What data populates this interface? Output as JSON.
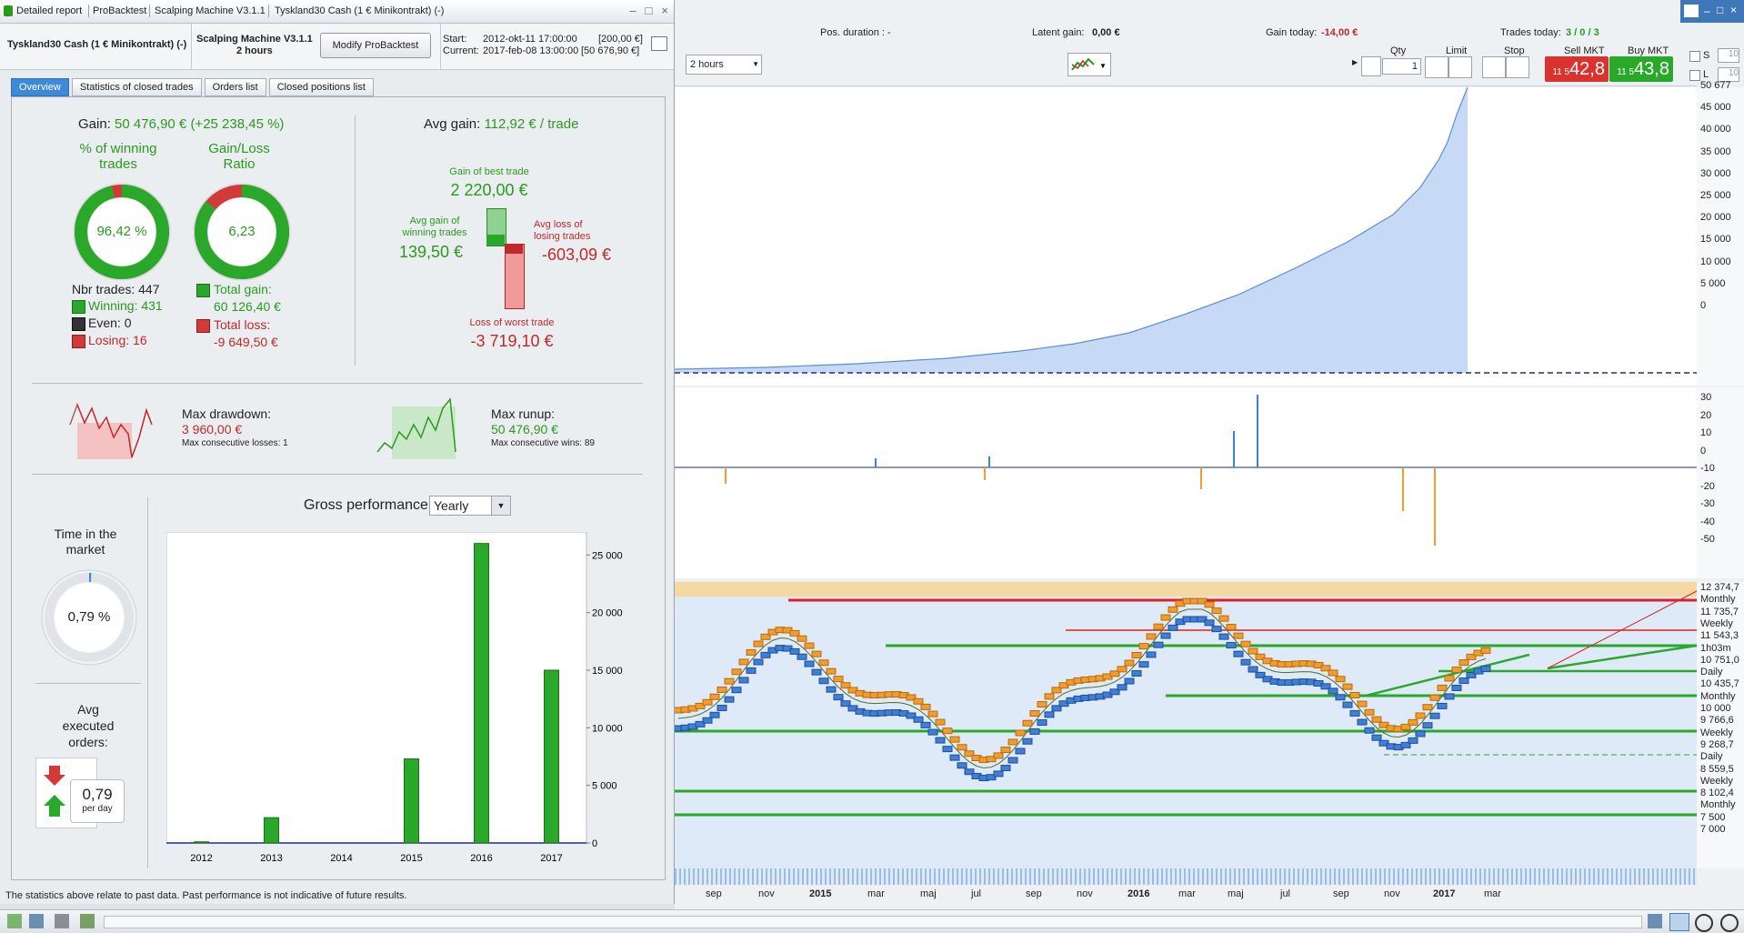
{
  "titlebar": {
    "items": [
      "Detailed report",
      "ProBacktest",
      "Scalping Machine V3.1.1",
      "Tyskland30 Cash (1 € Minikontrakt) (-)"
    ],
    "controls": [
      "–",
      "□",
      "×"
    ]
  },
  "header": {
    "instrument": "Tyskland30 Cash (1 € Minikontrakt) (-)",
    "system_name": "Scalping Machine V3.1.1",
    "timeframe": "2 hours",
    "modify_button": "Modify ProBacktest",
    "start_label": "Start:",
    "start_value": "2012-okt-11 17:00:00",
    "start_amount": "[200,00 €]",
    "current_label": "Current:",
    "current_value": "2017-feb-08 13:00:00",
    "current_amount": "[50 676,90 €]"
  },
  "tabs": [
    "Overview",
    "Statistics of closed trades",
    "Orders list",
    "Closed positions list"
  ],
  "overview": {
    "gain_label": "Gain:",
    "gain_value": "50 476,90 € (+25 238,45 %)",
    "winning_title_1": "% of winning",
    "winning_title_2": "trades",
    "winning_pct": "96,42 %",
    "winning_fraction": 0.9642,
    "ratio_title_1": "Gain/Loss",
    "ratio_title_2": "Ratio",
    "ratio_value": "6,23",
    "ratio_fraction": 0.862,
    "nbr_trades": "Nbr trades: 447",
    "winning": "Winning: 431",
    "even": "Even: 0",
    "losing": "Losing: 16",
    "total_gain_label": "Total gain:",
    "total_gain_value": "60 126,40 €",
    "total_loss_label": "Total loss:",
    "total_loss_value": "-9 649,50 €",
    "avg_gain_label": "Avg gain:",
    "avg_gain_value": "112,92 € / trade",
    "best_trade_label": "Gain of best trade",
    "best_trade_value": "2 220,00 €",
    "avg_win_label_1": "Avg gain of",
    "avg_win_label_2": "winning trades",
    "avg_win_value": "139,50 €",
    "avg_loss_label_1": "Avg loss of",
    "avg_loss_label_2": "losing trades",
    "avg_loss_value": "-603,09 €",
    "worst_trade_label": "Loss of worst trade",
    "worst_trade_value": "-3 719,10 €",
    "max_drawdown_label": "Max drawdown:",
    "max_drawdown_value": "3 960,00 €",
    "max_consec_losses": "Max consecutive losses: 1",
    "max_runup_label": "Max runup:",
    "max_runup_value": "50 476,90 €",
    "max_consec_wins": "Max consecutive wins: 89",
    "time_market_1": "Time in the",
    "time_market_2": "market",
    "time_market_value": "0,79 %",
    "time_market_fraction": 0.0079,
    "avg_orders_1": "Avg",
    "avg_orders_2": "executed",
    "avg_orders_3": "orders:",
    "avg_orders_value": "0,79",
    "avg_orders_unit": "per day",
    "gross_label": "Gross performance",
    "gross_period": "Yearly"
  },
  "chart_data": {
    "type": "bar",
    "categories": [
      "2012",
      "2013",
      "2014",
      "2015",
      "2016",
      "2017"
    ],
    "values": [
      100,
      2200,
      0,
      7300,
      26000,
      15000
    ],
    "ylim": [
      0,
      27000
    ],
    "yticks": [
      "0",
      "5 000",
      "10 000",
      "15 000",
      "20 000",
      "25 000"
    ],
    "ytick_values": [
      0,
      5000,
      10000,
      15000,
      20000,
      25000
    ],
    "bar_color": "#2aa82a"
  },
  "footer_note": "The statistics above relate to past data. Past performance is not indicative of future results.",
  "right_top": {
    "pos_duration": "Pos. duration : -",
    "latent_gain_label": "Latent gain:",
    "latent_gain_value": "0,00 €",
    "gain_today_label": "Gain today:",
    "gain_today_value": "-14,00 €",
    "trades_today_label": "Trades today:",
    "trades_today_value": "3 / 0 / 3",
    "timeframe_select": "2 hours",
    "qty_label": "Qty",
    "qty_value": "1",
    "limit_label": "Limit",
    "stop_label": "Stop",
    "sell_label": "Sell MKT",
    "sell_small": "11 5",
    "sell_big": "42,8",
    "buy_label": "Buy MKT",
    "buy_small": "11 5",
    "buy_big": "43,8",
    "s_label": "S",
    "s_value": "10",
    "l_label": "L",
    "l_value": "10"
  },
  "equity_axis": [
    "50 677",
    "45 000",
    "40 000",
    "35 000",
    "30 000",
    "25 000",
    "20 000",
    "15 000",
    "10 000",
    "5 000",
    "0"
  ],
  "hist_axis": [
    "30",
    "20",
    "10",
    "0",
    "-10",
    "-20",
    "-30",
    "-40",
    "-50"
  ],
  "price_axis": [
    "12 374,7",
    "Monthly",
    "11 735,7",
    "Weekly",
    "11 543,3",
    "1h03m",
    "10 751,0",
    "Daily",
    "10 435,7",
    "Monthly",
    "10 000",
    "9 766,6",
    "Weekly",
    "9 268,7",
    "Daily",
    "8 559,5",
    "Weekly",
    "8 102,4",
    "Monthly",
    "7 500",
    "7 000"
  ],
  "x_axis": [
    "sep",
    "nov",
    "2015",
    "mar",
    "maj",
    "jul",
    "sep",
    "nov",
    "2016",
    "mar",
    "maj",
    "jul",
    "sep",
    "nov",
    "2017",
    "mar"
  ],
  "colors": {
    "accent": "#3f8ad8",
    "green": "#2a9a1e",
    "red": "#c0282a",
    "equity_fill": "#c6d9f5"
  }
}
